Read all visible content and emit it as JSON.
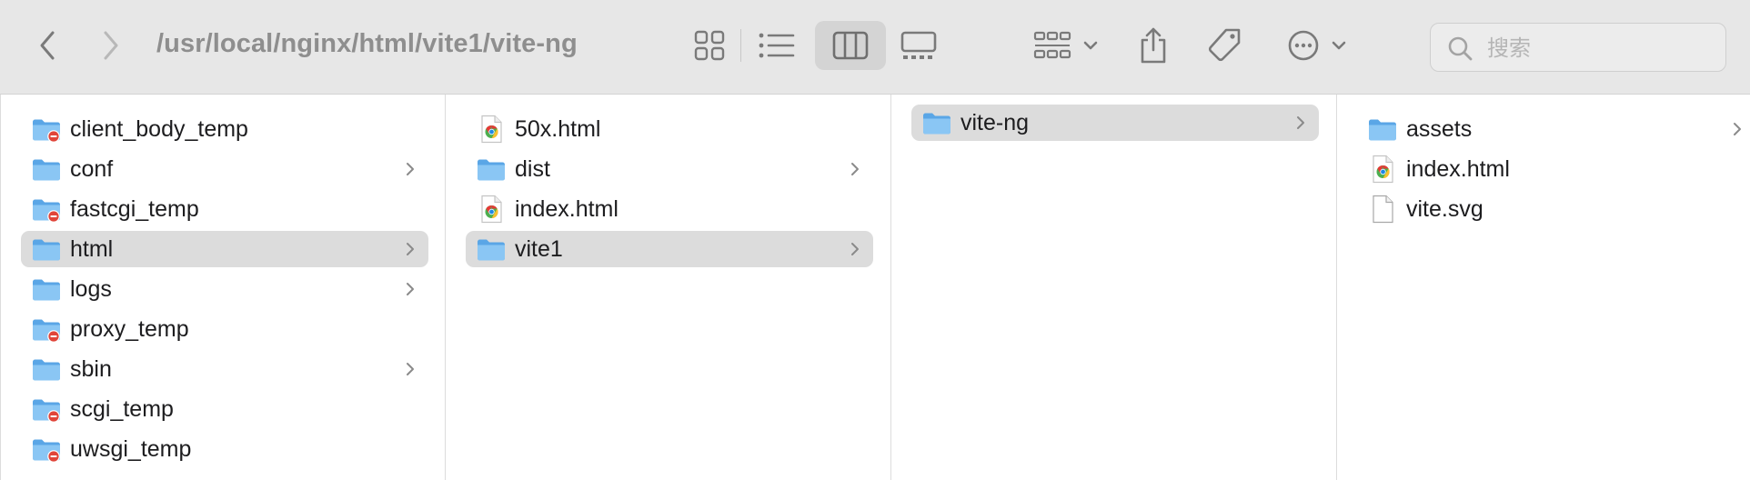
{
  "toolbar": {
    "path": "/usr/local/nginx/html/vite1/vite-ng",
    "search_placeholder": "搜索",
    "accent": "#5aa6e6"
  },
  "columns": [
    {
      "items": [
        {
          "label": "client_body_temp",
          "icon": "folder-restricted-icon",
          "chevron": false,
          "selected": false
        },
        {
          "label": "conf",
          "icon": "folder-icon",
          "chevron": true,
          "selected": false
        },
        {
          "label": "fastcgi_temp",
          "icon": "folder-restricted-icon",
          "chevron": false,
          "selected": false
        },
        {
          "label": "html",
          "icon": "folder-icon",
          "chevron": true,
          "selected": true
        },
        {
          "label": "logs",
          "icon": "folder-icon",
          "chevron": true,
          "selected": false
        },
        {
          "label": "proxy_temp",
          "icon": "folder-restricted-icon",
          "chevron": false,
          "selected": false
        },
        {
          "label": "sbin",
          "icon": "folder-icon",
          "chevron": true,
          "selected": false
        },
        {
          "label": "scgi_temp",
          "icon": "folder-restricted-icon",
          "chevron": false,
          "selected": false
        },
        {
          "label": "uwsgi_temp",
          "icon": "folder-restricted-icon",
          "chevron": false,
          "selected": false
        }
      ]
    },
    {
      "items": [
        {
          "label": "50x.html",
          "icon": "chrome-html-file-icon",
          "chevron": false,
          "selected": false
        },
        {
          "label": "dist",
          "icon": "folder-icon",
          "chevron": true,
          "selected": false
        },
        {
          "label": "index.html",
          "icon": "chrome-html-file-icon",
          "chevron": false,
          "selected": false
        },
        {
          "label": "vite1",
          "icon": "folder-icon",
          "chevron": true,
          "selected": true
        }
      ]
    },
    {
      "items": [
        {
          "label": "vite-ng",
          "icon": "folder-icon",
          "chevron": true,
          "selected": true
        }
      ]
    },
    {
      "items": [
        {
          "label": "assets",
          "icon": "folder-icon",
          "chevron": true,
          "selected": false
        },
        {
          "label": "index.html",
          "icon": "chrome-html-file-icon",
          "chevron": false,
          "selected": false
        },
        {
          "label": "vite.svg",
          "icon": "blank-file-icon",
          "chevron": false,
          "selected": false
        }
      ]
    }
  ]
}
